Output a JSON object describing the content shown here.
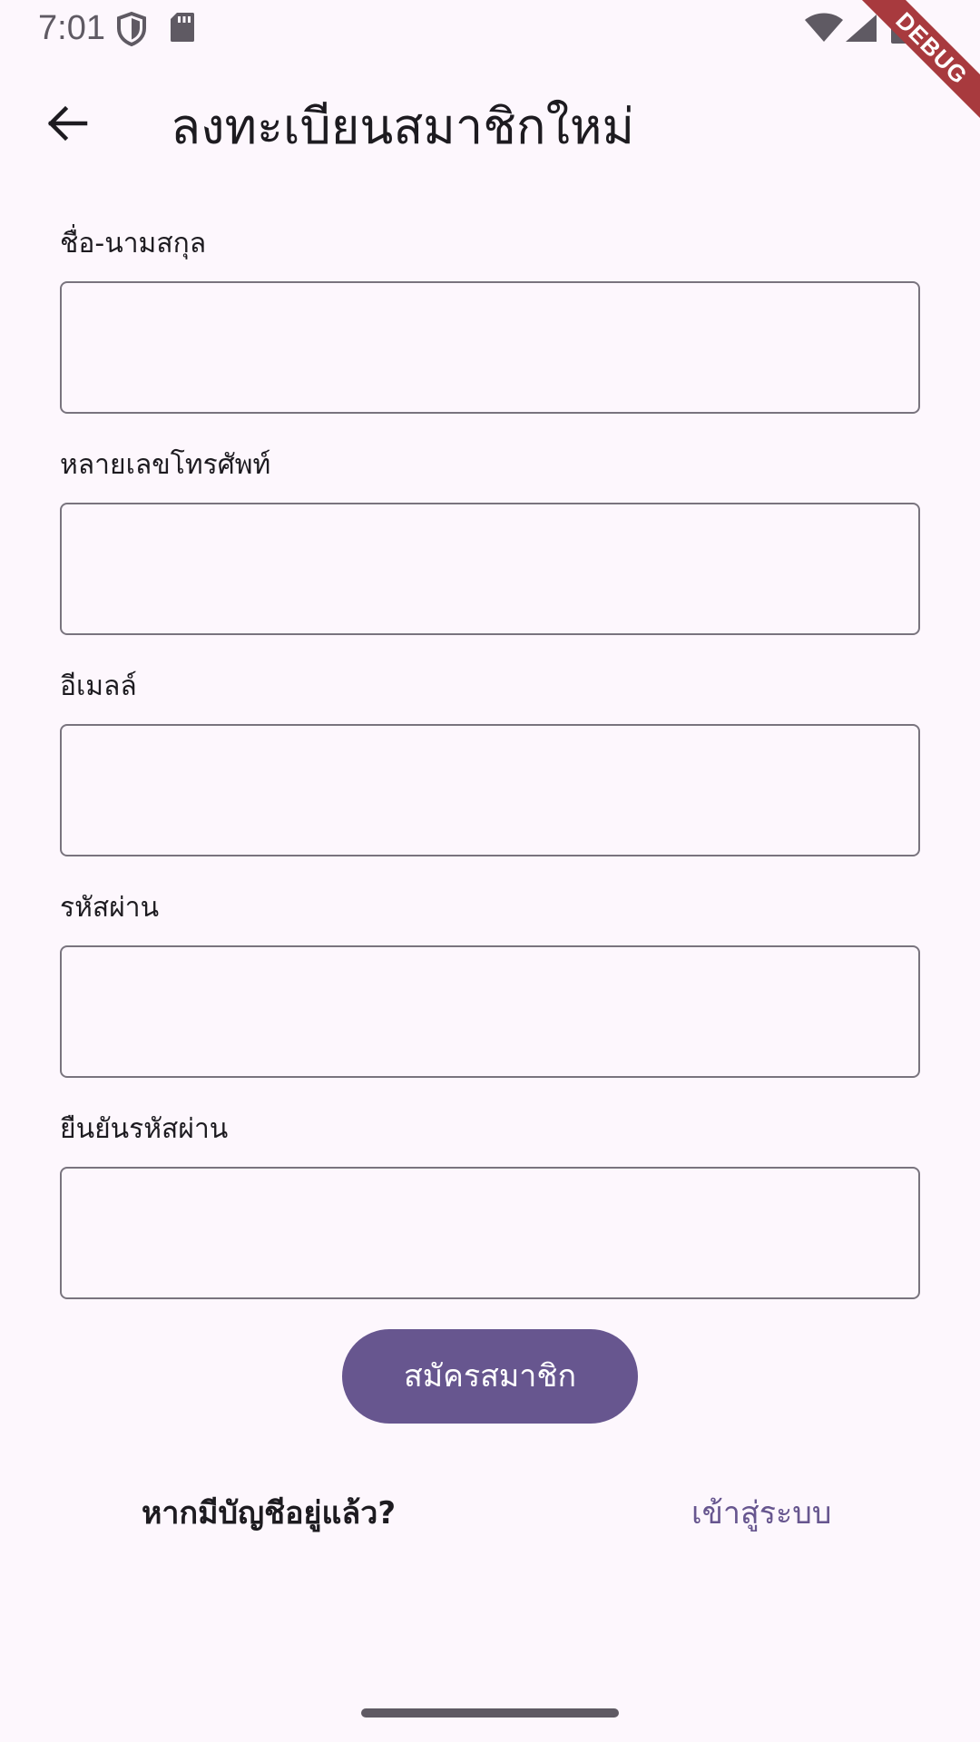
{
  "status_bar": {
    "time": "7:01",
    "icons": [
      "shield-icon",
      "sd-card-icon",
      "wifi-icon",
      "signal-icon",
      "battery-icon"
    ],
    "debug_label": "DEBUG"
  },
  "app_bar": {
    "back_icon": "arrow-left-icon",
    "title": "ลงทะเบียนสมาชิกใหม่"
  },
  "form": {
    "fields": [
      {
        "label": "ชื่อ-นามสกุล",
        "value": "",
        "placeholder": ""
      },
      {
        "label": "หลายเลขโทรศัพท์",
        "value": "",
        "placeholder": ""
      },
      {
        "label": "อีเมลล์",
        "value": "",
        "placeholder": ""
      },
      {
        "label": "รหัสผ่าน",
        "value": "",
        "placeholder": ""
      },
      {
        "label": "ยืนยันรหัสผ่าน",
        "value": "",
        "placeholder": ""
      }
    ],
    "submit_label": "สมัครสมาชิก"
  },
  "login": {
    "prompt": "หากมีบัญชีอยู่แล้ว?",
    "link_label": "เข้าสู่ระบบ"
  },
  "colors": {
    "background": "#fdf7fd",
    "primary": "#67568f",
    "outline": "#79747e",
    "debug_ribbon": "#a83a3e"
  }
}
